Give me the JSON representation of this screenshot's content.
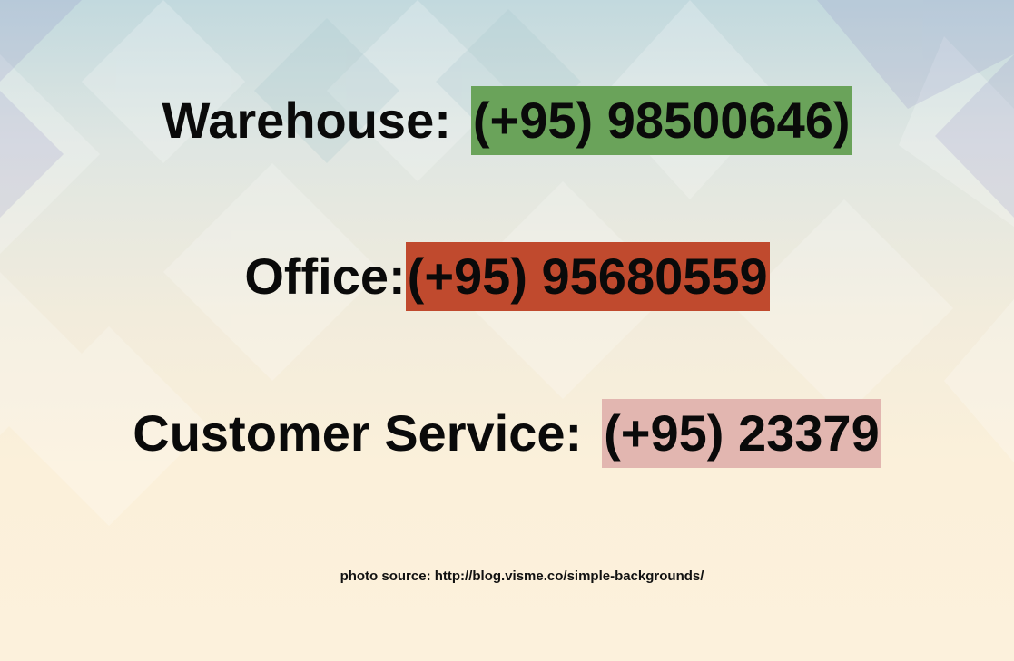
{
  "contacts": {
    "warehouse": {
      "label": "Warehouse:",
      "number": "(+95) 98500646)"
    },
    "office": {
      "label": "Office:",
      "number": "(+95) 95680559"
    },
    "customer_service": {
      "label": "Customer Service:",
      "number": "(+95) 23379"
    }
  },
  "footer": {
    "source_text": "photo source: http://blog.visme.co/simple-backgrounds/"
  },
  "colors": {
    "warehouse_highlight": "#6aa35a",
    "office_highlight": "#c04a2e",
    "customer_highlight": "#e2b6b0"
  }
}
